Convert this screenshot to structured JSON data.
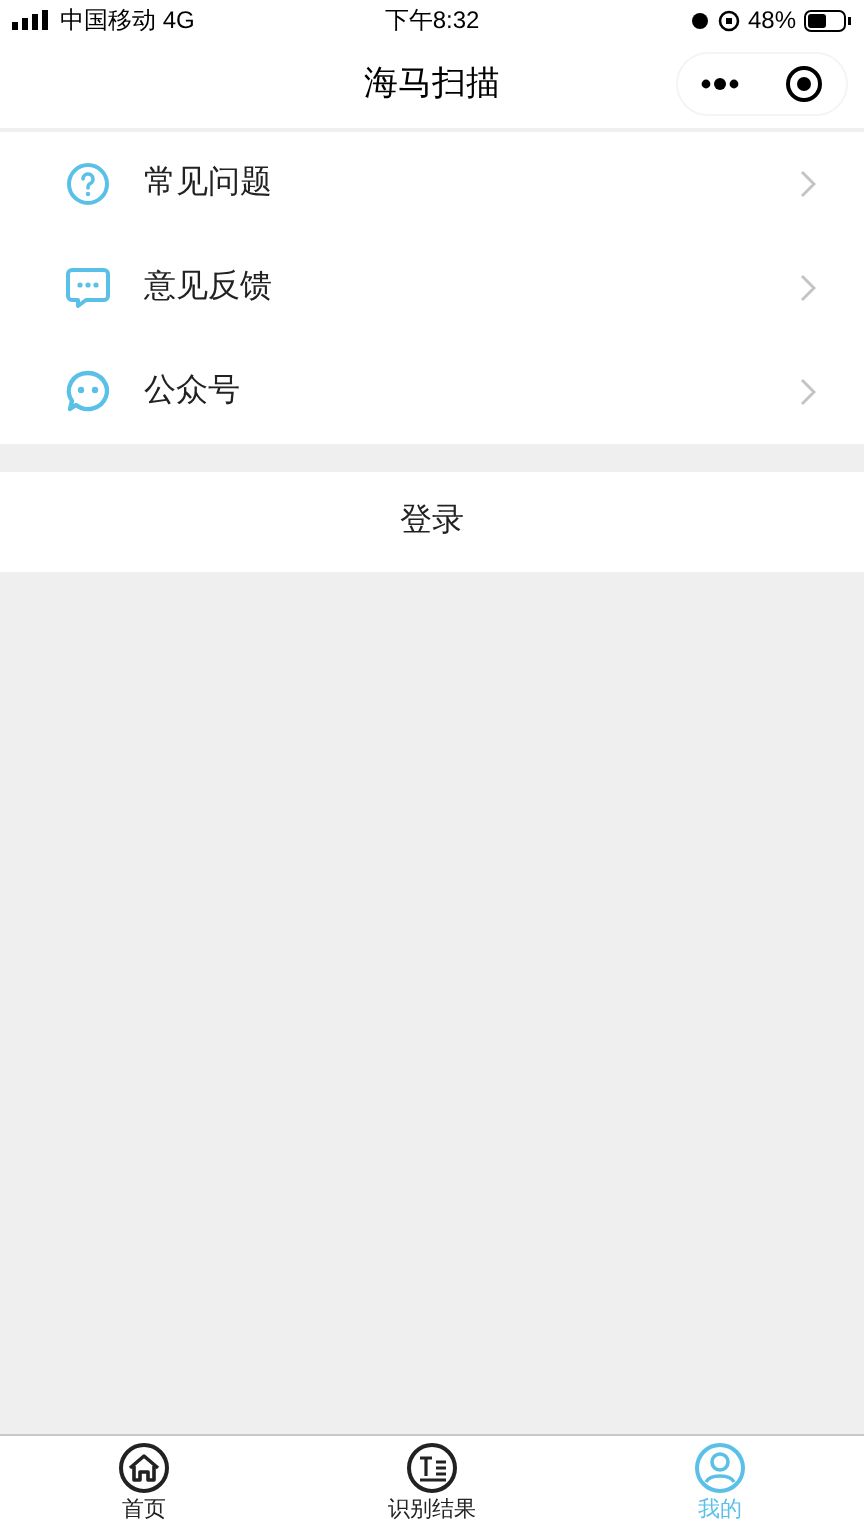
{
  "status_bar": {
    "carrier": "中国移动 4G",
    "time": "下午8:32",
    "battery": "48%"
  },
  "nav": {
    "title": "海马扫描"
  },
  "menu": [
    {
      "kind": "question",
      "label": "常见问题"
    },
    {
      "kind": "chat",
      "label": "意见反馈"
    },
    {
      "kind": "face",
      "label": "公众号"
    }
  ],
  "login_button": "登录",
  "tab_bar": [
    {
      "kind": "home",
      "label": "首页",
      "selected": false
    },
    {
      "kind": "text",
      "label": "识别结果",
      "selected": false
    },
    {
      "kind": "user",
      "label": "我的",
      "selected": true
    }
  ]
}
